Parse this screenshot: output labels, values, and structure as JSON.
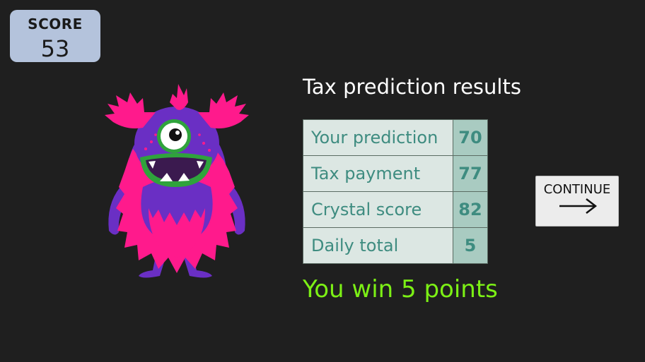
{
  "score": {
    "label": "SCORE",
    "value": "53"
  },
  "title": "Tax prediction results",
  "results": [
    {
      "label": "Your prediction",
      "value": "70"
    },
    {
      "label": "Tax payment",
      "value": "77"
    },
    {
      "label": "Crystal score",
      "value": "82"
    },
    {
      "label": "Daily total",
      "value": "5"
    }
  ],
  "win_message": "You win 5 points",
  "continue_button": {
    "label": "CONTINUE",
    "icon": "arrow-right-icon"
  },
  "colors": {
    "background": "#1f1f1f",
    "score_box": "#b4c3dc",
    "table_label_bg": "#dce7e3",
    "table_value_bg": "#a9cbc1",
    "table_text": "#3e8c80",
    "win_text": "#7cf015",
    "monster_pink": "#ff1a8c",
    "monster_purple": "#6a2fc4",
    "monster_mouth": "#2fa33c"
  }
}
